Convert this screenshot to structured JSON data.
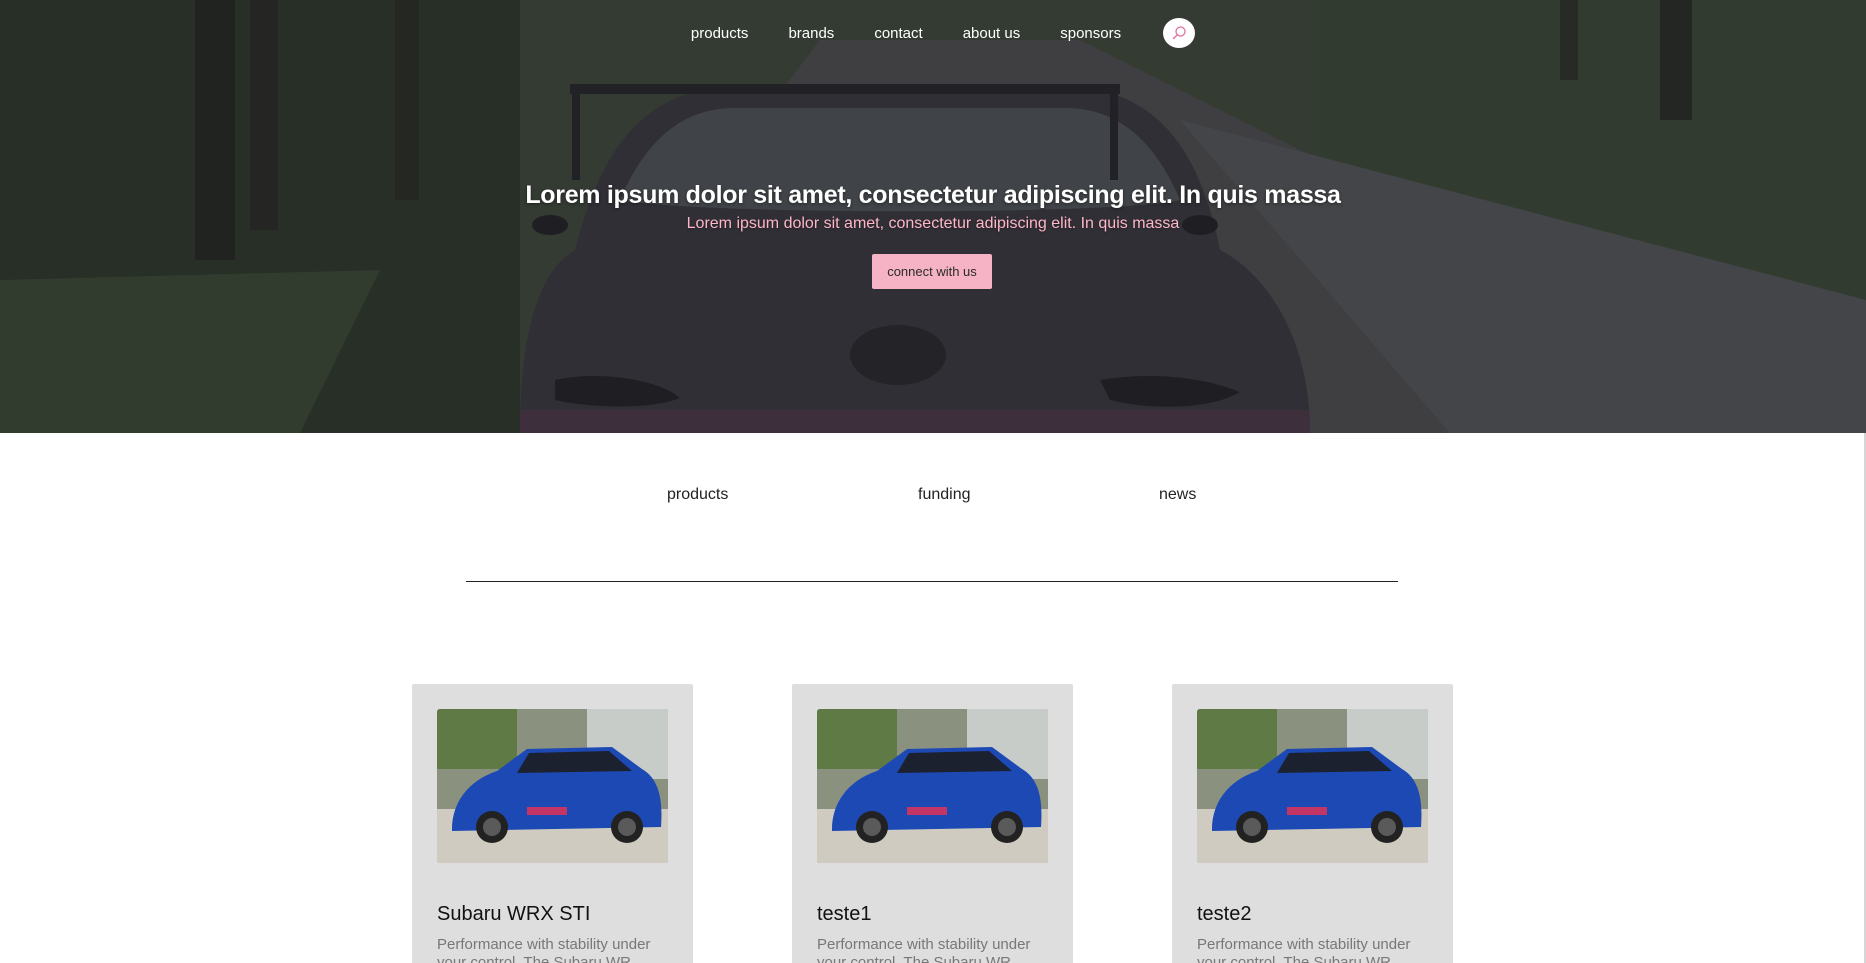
{
  "nav": {
    "items": [
      {
        "label": "products"
      },
      {
        "label": "brands"
      },
      {
        "label": "contact"
      },
      {
        "label": "about us"
      },
      {
        "label": "sponsors"
      }
    ],
    "search_icon": "search-icon"
  },
  "hero": {
    "title": "Lorem ipsum dolor sit amet, consectetur adipiscing elit. In quis massa",
    "subtitle": "Lorem ipsum dolor sit amet, consectetur adipiscing elit. In quis massa",
    "cta_label": "connect with us"
  },
  "section_tabs": [
    {
      "label": "products"
    },
    {
      "label": "funding"
    },
    {
      "label": "news"
    }
  ],
  "cards": [
    {
      "title": "Subaru WRX STI",
      "desc": "Performance with stability under your control. The Subaru WR..."
    },
    {
      "title": "teste1",
      "desc": "Performance with stability under your control. The Subaru WR..."
    },
    {
      "title": "teste2",
      "desc": "Performance with stability under your control. The Subaru WR..."
    }
  ],
  "colors": {
    "accent_pink": "#f6b3c6",
    "subtitle_pink": "#ffb6c8",
    "card_bg": "#dedede",
    "car_blue": "#1d49b5"
  }
}
